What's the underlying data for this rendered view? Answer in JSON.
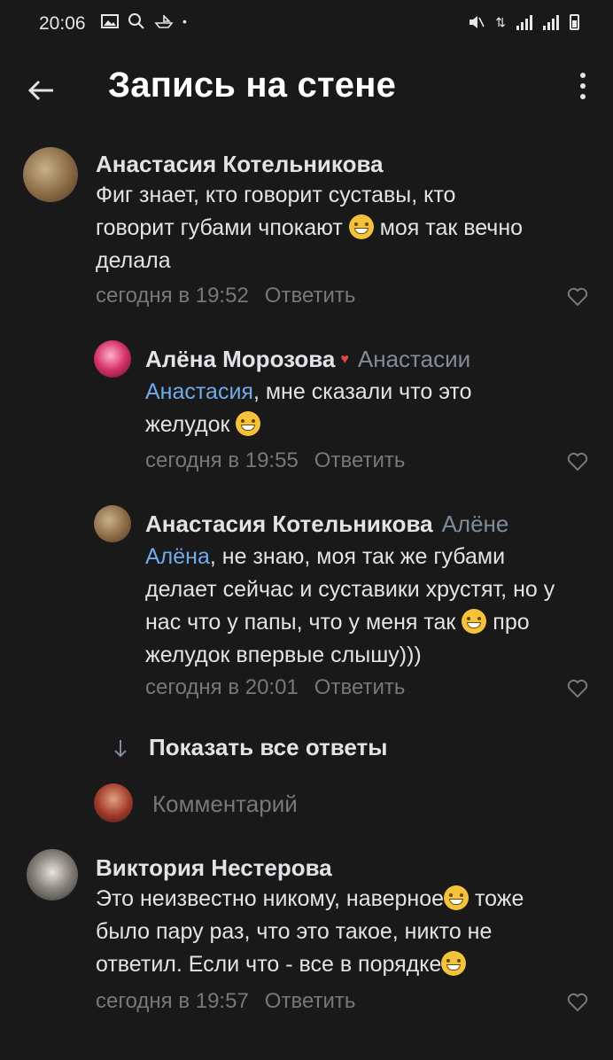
{
  "status_bar": {
    "time": "20:06"
  },
  "header": {
    "title": "Запись на стене"
  },
  "comments": [
    {
      "author": "Анастасия Котельникова",
      "text": "Фиг знает, кто говорит суставы, кто говорит губами чпокают",
      "text_after": "моя так вечно делала",
      "time": "сегодня в 19:52",
      "reply_label": "Ответить"
    },
    {
      "author": "Алёна Морозова",
      "reply_to": "Анастасии",
      "mention": "Анастасия",
      "text": ", мне сказали что это желудок",
      "time": "сегодня в 19:55",
      "reply_label": "Ответить"
    },
    {
      "author": "Анастасия Котельникова",
      "reply_to": "Алёне",
      "mention": "Алёна",
      "text": ", не знаю, моя так же губами делает сейчас и суставики хрустят, но у нас что у папы, что у меня так",
      "text_after": "про желудок впервые слышу)))",
      "time": "сегодня в 20:01",
      "reply_label": "Ответить"
    },
    {
      "author": "Виктория Нестерова",
      "text": "Это неизвестно никому, наверное",
      "text_after": "тоже было пару раз, что это такое, никто не ответил. Если что - все в порядке",
      "time": "сегодня в 19:57",
      "reply_label": "Ответить"
    }
  ],
  "show_all_replies": "Показать все ответы",
  "comment_input": {
    "placeholder": "Комментарий"
  },
  "colors": {
    "background": "#19191a",
    "mention": "#71aaeb",
    "secondary": "#76787a",
    "emoji": "#f5c33b"
  }
}
